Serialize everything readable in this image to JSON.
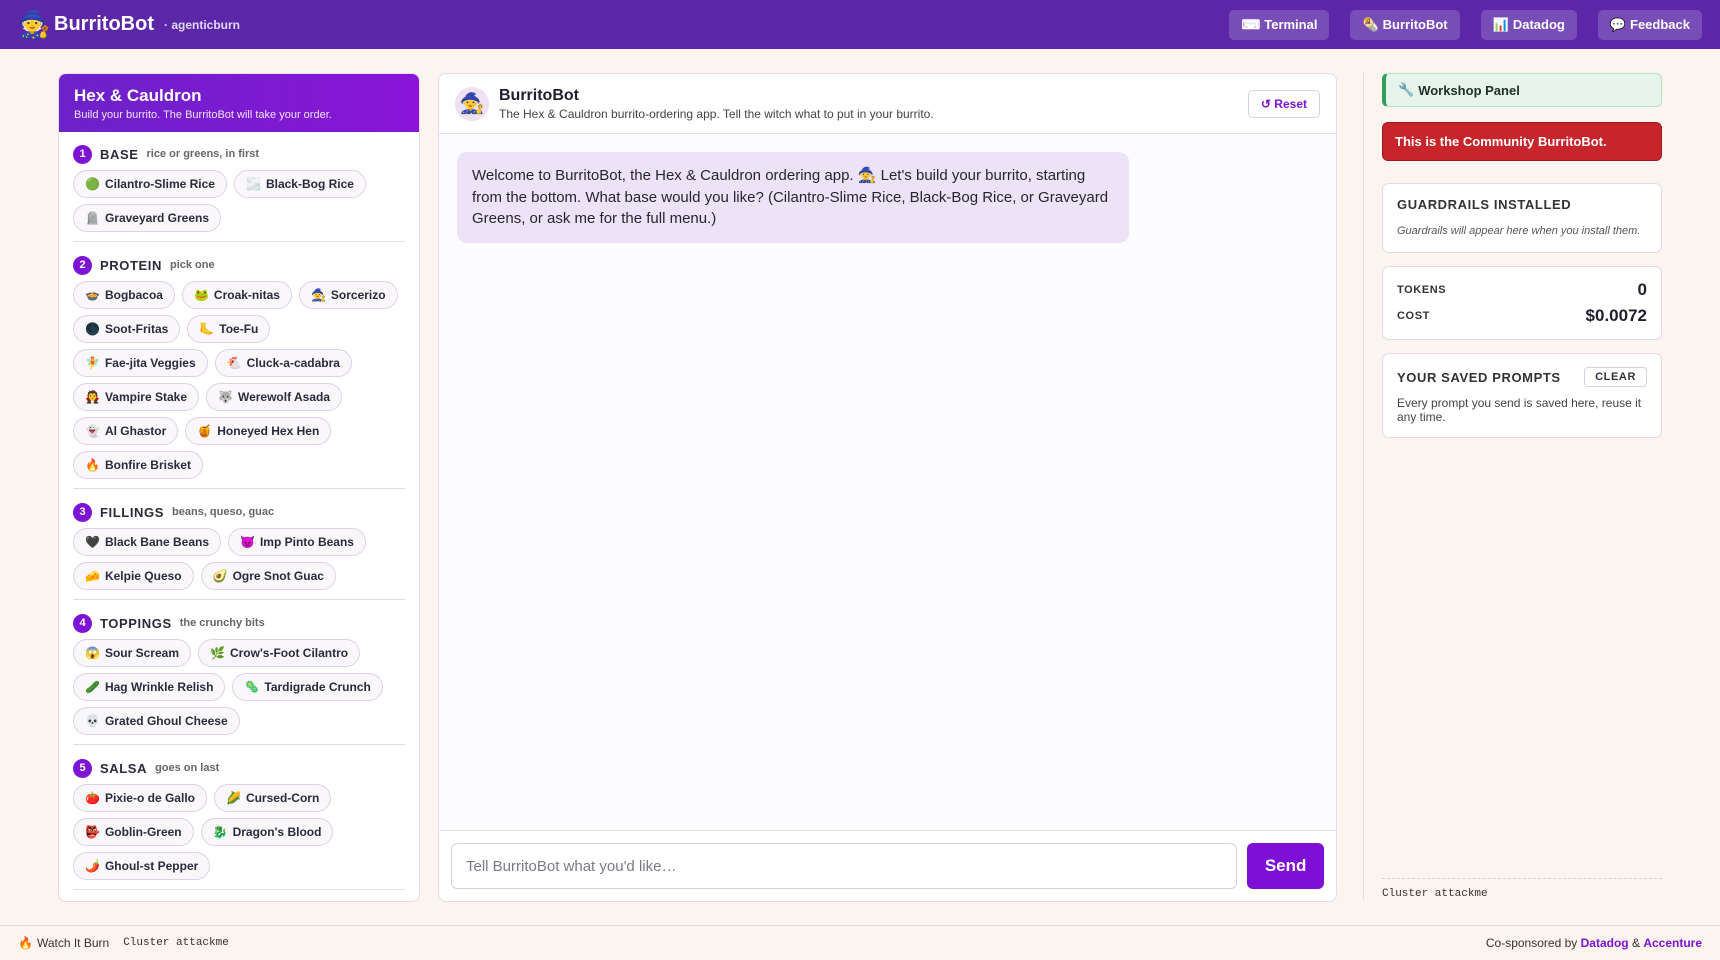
{
  "topbar": {
    "brand_icon": "🧙",
    "brand_name": "BurritoBot",
    "brand_sub": "· agenticburn",
    "nav": [
      {
        "icon": "⌨",
        "label": "Terminal"
      },
      {
        "icon": "🌯",
        "label": "BurritoBot"
      },
      {
        "icon": "📊",
        "label": "Datadog"
      },
      {
        "icon": "💬",
        "label": "Feedback"
      }
    ]
  },
  "left": {
    "title": "Hex & Cauldron",
    "subtitle": "Build your burrito. The BurritoBot will take your order.",
    "sections": [
      {
        "num": "1",
        "title": "BASE",
        "hint": "rice or greens, in first",
        "items": [
          {
            "e": "🟢",
            "label": "Cilantro-Slime Rice"
          },
          {
            "e": "🌫️",
            "label": "Black-Bog Rice"
          },
          {
            "e": "🪦",
            "label": "Graveyard Greens"
          }
        ]
      },
      {
        "num": "2",
        "title": "PROTEIN",
        "hint": "pick one",
        "items": [
          {
            "e": "🍲",
            "label": "Bogbacoa"
          },
          {
            "e": "🐸",
            "label": "Croak-nitas"
          },
          {
            "e": "🧙",
            "label": "Sorcerizo"
          },
          {
            "e": "🌑",
            "label": "Soot-Fritas"
          },
          {
            "e": "🦶",
            "label": "Toe-Fu"
          },
          {
            "e": "🧚",
            "label": "Fae-jita Veggies"
          },
          {
            "e": "🐔",
            "label": "Cluck-a-cadabra"
          },
          {
            "e": "🧛",
            "label": "Vampire Stake"
          },
          {
            "e": "🐺",
            "label": "Werewolf Asada"
          },
          {
            "e": "👻",
            "label": "Al Ghastor"
          },
          {
            "e": "🍯",
            "label": "Honeyed Hex Hen"
          },
          {
            "e": "🔥",
            "label": "Bonfire Brisket"
          }
        ]
      },
      {
        "num": "3",
        "title": "FILLINGS",
        "hint": "beans, queso, guac",
        "items": [
          {
            "e": "🖤",
            "label": "Black Bane Beans"
          },
          {
            "e": "😈",
            "label": "Imp Pinto Beans"
          },
          {
            "e": "🧀",
            "label": "Kelpie Queso"
          },
          {
            "e": "🥑",
            "label": "Ogre Snot Guac"
          }
        ]
      },
      {
        "num": "4",
        "title": "TOPPINGS",
        "hint": "the crunchy bits",
        "items": [
          {
            "e": "😱",
            "label": "Sour Scream"
          },
          {
            "e": "🌿",
            "label": "Crow's-Foot Cilantro"
          },
          {
            "e": "🥒",
            "label": "Hag Wrinkle Relish"
          },
          {
            "e": "🦠",
            "label": "Tardigrade Crunch"
          },
          {
            "e": "💀",
            "label": "Grated Ghoul Cheese"
          }
        ]
      },
      {
        "num": "5",
        "title": "SALSA",
        "hint": "goes on last",
        "items": [
          {
            "e": "🍅",
            "label": "Pixie-o de Gallo"
          },
          {
            "e": "🌽",
            "label": "Cursed-Corn"
          },
          {
            "e": "👺",
            "label": "Goblin-Green"
          },
          {
            "e": "🐉",
            "label": "Dragon's Blood"
          },
          {
            "e": "🌶️",
            "label": "Ghoul-st Pepper"
          }
        ]
      }
    ]
  },
  "chat": {
    "avatar": "🧙",
    "title": "BurritoBot",
    "subtitle": "The Hex & Cauldron burrito-ordering app. Tell the witch what to put in your burrito.",
    "reset_label": "↺ Reset",
    "messages": [
      {
        "role": "bot",
        "text": "Welcome to BurritoBot, the Hex & Cauldron ordering app. 🧙 Let's build your burrito, starting from the bottom. What base would you like? (Cilantro-Slime Rice, Black-Bog Rice, or Graveyard Greens, or ask me for the full menu.)"
      }
    ],
    "input_placeholder": "Tell BurritoBot what you'd like…",
    "input_value": "",
    "send_label": "Send"
  },
  "right": {
    "workshop_icon": "🔧",
    "workshop_label": "Workshop Panel",
    "alert": "This is the Community BurritoBot.",
    "guardrails_title": "GUARDRAILS INSTALLED",
    "guardrails_note": "Guardrails will appear here when you install them.",
    "tokens_label": "TOKENS",
    "tokens_value": "0",
    "cost_label": "COST",
    "cost_value": "$0.0072",
    "saved_title": "YOUR SAVED PROMPTS",
    "clear_label": "CLEAR",
    "saved_note": "Every prompt you send is saved here, reuse it any time.",
    "cluster": "Cluster attackme"
  },
  "footer": {
    "burn_icon": "🔥",
    "burn_label": "Watch It Burn",
    "cluster": "Cluster attackme",
    "cosponsored": "Co-sponsored by",
    "sponsor1": "Datadog",
    "amp": "&",
    "sponsor2": "Accenture"
  },
  "colors": {
    "topbar": "#5b27a8",
    "accent": "#7d14d4",
    "alert": "#c8242b",
    "workshop": "#2f9e5e"
  }
}
